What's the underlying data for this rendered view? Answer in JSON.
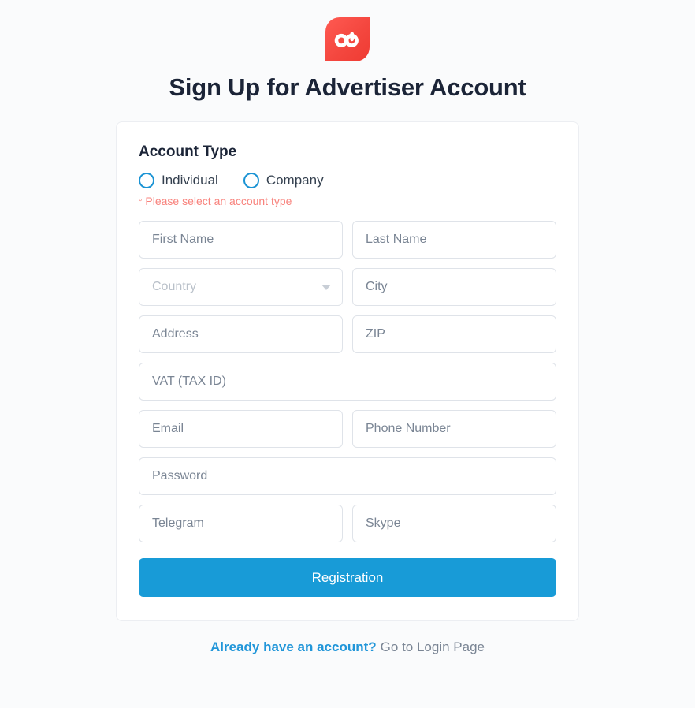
{
  "brand": {
    "logo_icon": "ad-infinity-logo-icon",
    "logo_color": "#f4473f",
    "logo_glyph_color": "#ffffff"
  },
  "header": {
    "title": "Sign Up for Advertiser Account"
  },
  "form": {
    "section_title": "Account Type",
    "account_type": {
      "options": [
        {
          "label": "Individual",
          "value": "individual",
          "selected": false
        },
        {
          "label": "Company",
          "value": "company",
          "selected": false
        }
      ],
      "error": "Please select an account type",
      "error_bullet": "°",
      "error_color": "#f8827c",
      "radio_color": "#1a93d4"
    },
    "fields": {
      "first_name": {
        "placeholder": "First Name",
        "value": ""
      },
      "last_name": {
        "placeholder": "Last Name",
        "value": ""
      },
      "country": {
        "placeholder": "Country",
        "value": "",
        "icon": "chevron-down-icon"
      },
      "city": {
        "placeholder": "City",
        "value": ""
      },
      "address": {
        "placeholder": "Address",
        "value": ""
      },
      "zip": {
        "placeholder": "ZIP",
        "value": ""
      },
      "vat": {
        "placeholder": "VAT (TAX ID)",
        "value": ""
      },
      "email": {
        "placeholder": "Email",
        "value": ""
      },
      "phone": {
        "placeholder": "Phone Number",
        "value": ""
      },
      "password": {
        "placeholder": "Password",
        "value": ""
      },
      "telegram": {
        "placeholder": "Telegram",
        "value": ""
      },
      "skype": {
        "placeholder": "Skype",
        "value": ""
      }
    },
    "submit_label": "Registration",
    "submit_color": "#189bd7"
  },
  "footer": {
    "prompt": "Already have an account?",
    "link_label": "Go to Login Page",
    "prompt_color": "#2196d9"
  }
}
